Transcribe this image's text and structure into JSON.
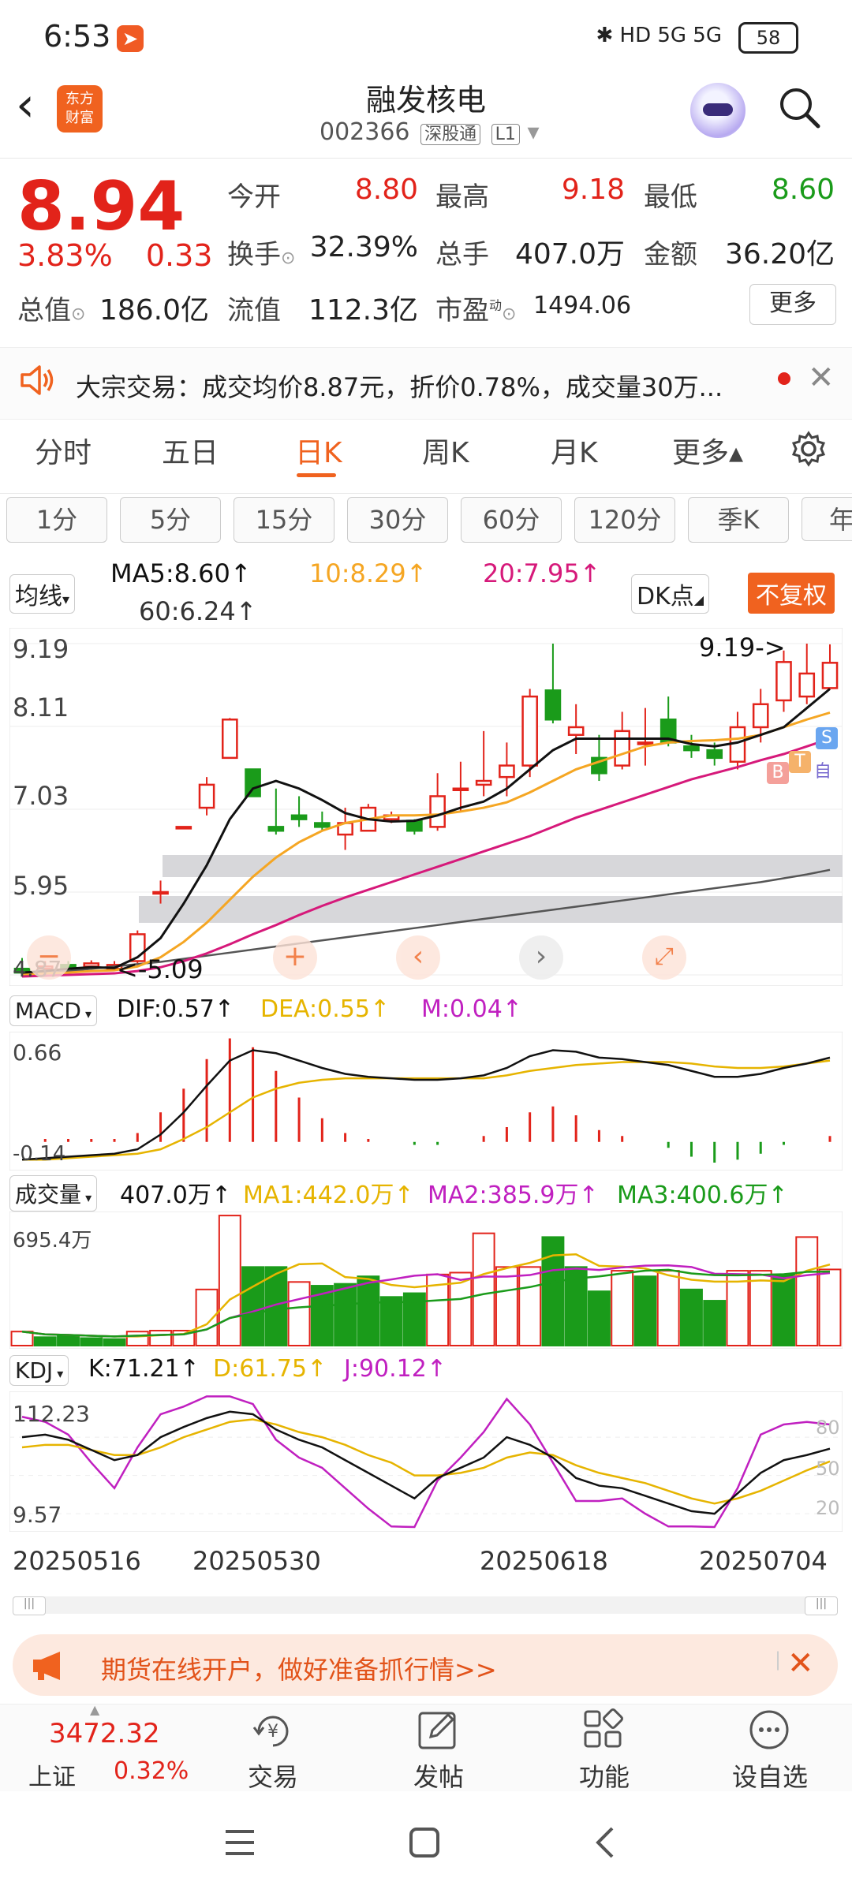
{
  "status_bar": {
    "time": "6:53",
    "icons": "✱ HD 5G 5G",
    "battery": "58"
  },
  "header": {
    "logo_line1": "东方",
    "logo_line2": "财富",
    "title": "融发核电",
    "code": "002366",
    "tag1": "深股通",
    "tag2": "L1"
  },
  "quote": {
    "price": "8.94",
    "change_pct": "3.83%",
    "change": "0.33",
    "open_label": "今开",
    "open": "8.80",
    "high_label": "最高",
    "high": "9.18",
    "low_label": "最低",
    "low": "8.60",
    "turnover_label": "换手",
    "turnover": "32.39%",
    "volume_label": "总手",
    "volume": "407.0万",
    "amount_label": "金额",
    "amount": "36.20亿",
    "mktcap_label": "总值",
    "mktcap": "186.0亿",
    "float_label": "流值",
    "float": "112.3亿",
    "pe_label": "市盈",
    "pe_sup": "动",
    "pe": "1494.06",
    "more": "更多"
  },
  "notice": {
    "text": "大宗交易：成交均价8.87元，折价0.78%，成交量30万..."
  },
  "tabs": [
    "分时",
    "五日",
    "日K",
    "周K",
    "月K",
    "更多▴"
  ],
  "periods": [
    "1分",
    "5分",
    "15分",
    "30分",
    "60分",
    "120分",
    "季K",
    "年"
  ],
  "indicators": {
    "ma_btn": "均线",
    "ma5": "MA5:8.60↑",
    "ma10": "10:8.29↑",
    "ma20": "20:7.95↑",
    "ma60": "60:6.24↑",
    "dk_btn": "DK点",
    "fuquan_btn": "不复权",
    "price_high_note": "9.19->",
    "price_low_note": "<-5.09",
    "ticks": [
      "9.19",
      "8.11",
      "7.03",
      "5.95",
      "4.87"
    ],
    "signal_b": "B",
    "signal_t": "T",
    "signal_s": "S",
    "signal_zi": "自"
  },
  "macd": {
    "btn": "MACD",
    "dif": "DIF:0.57↑",
    "dea": "DEA:0.55↑",
    "m": "M:0.04↑",
    "top": "0.66",
    "bottom": "-0.14"
  },
  "volume": {
    "btn": "成交量",
    "total": "407.0万↑",
    "ma1": "MA1:442.0万↑",
    "ma2": "MA2:385.9万↑",
    "ma3": "MA3:400.6万↑",
    "top": "695.4万"
  },
  "kdj": {
    "btn": "KDJ",
    "k": "K:71.21↑",
    "d": "D:61.75↑",
    "j": "J:90.12↑",
    "top": "112.23",
    "bottom": "9.57",
    "r80": "80",
    "r50": "50",
    "r20": "20"
  },
  "dates": [
    "20250516",
    "20250530",
    "20250618",
    "20250704"
  ],
  "ad": {
    "text": "期货在线开户，做好准备抓行情>>"
  },
  "bottom_nav": {
    "index_value": "3472.32",
    "index_name": "上证",
    "index_pct": "0.32%",
    "trade": "交易",
    "post": "发帖",
    "func": "功能",
    "watch": "设自选"
  },
  "colors": {
    "up": "#e2231a",
    "down": "#1a9b1a",
    "accent": "#f0621f",
    "ma5": "#111111",
    "ma10": "#f5a623",
    "ma20": "#d6197a",
    "ma60": "#555555"
  },
  "chart_data": {
    "type": "candlestick",
    "price_ticks": [
      9.19,
      8.11,
      7.03,
      5.95,
      4.87
    ],
    "ylim": [
      4.87,
      9.19
    ],
    "candles": [
      {
        "o": 4.95,
        "c": 4.9,
        "h": 5.09,
        "l": 4.88
      },
      {
        "o": 4.95,
        "c": 4.98,
        "h": 5.05,
        "l": 4.9
      },
      {
        "o": 5.0,
        "c": 4.95,
        "h": 5.05,
        "l": 4.92
      },
      {
        "o": 4.98,
        "c": 5.02,
        "h": 5.06,
        "l": 4.95
      },
      {
        "o": 4.95,
        "c": 5.0,
        "h": 5.05,
        "l": 4.92
      },
      {
        "o": 5.05,
        "c": 5.4,
        "h": 5.45,
        "l": 5.0
      },
      {
        "o": 5.95,
        "c": 5.95,
        "h": 6.1,
        "l": 5.8
      },
      {
        "o": 6.8,
        "c": 6.8,
        "h": 6.8,
        "l": 6.8
      },
      {
        "o": 7.05,
        "c": 7.35,
        "h": 7.45,
        "l": 6.95
      },
      {
        "o": 7.7,
        "c": 8.2,
        "h": 8.22,
        "l": 7.7
      },
      {
        "o": 7.55,
        "c": 7.2,
        "h": 7.55,
        "l": 7.2
      },
      {
        "o": 6.8,
        "c": 6.75,
        "h": 7.3,
        "l": 6.7
      },
      {
        "o": 6.95,
        "c": 6.9,
        "h": 7.2,
        "l": 6.8
      },
      {
        "o": 6.85,
        "c": 6.8,
        "h": 7.0,
        "l": 6.75
      },
      {
        "o": 6.7,
        "c": 6.85,
        "h": 7.05,
        "l": 6.5
      },
      {
        "o": 6.75,
        "c": 7.05,
        "h": 7.1,
        "l": 6.75
      },
      {
        "o": 6.9,
        "c": 6.95,
        "h": 7.0,
        "l": 6.85
      },
      {
        "o": 6.88,
        "c": 6.75,
        "h": 6.9,
        "l": 6.7
      },
      {
        "o": 6.8,
        "c": 7.2,
        "h": 7.5,
        "l": 6.75
      },
      {
        "o": 7.3,
        "c": 7.3,
        "h": 7.65,
        "l": 7.0
      },
      {
        "o": 7.35,
        "c": 7.4,
        "h": 8.05,
        "l": 7.2
      },
      {
        "o": 7.45,
        "c": 7.6,
        "h": 7.9,
        "l": 7.2
      },
      {
        "o": 7.6,
        "c": 8.5,
        "h": 8.6,
        "l": 7.45
      },
      {
        "o": 8.58,
        "c": 8.2,
        "h": 9.19,
        "l": 8.15
      },
      {
        "o": 8.0,
        "c": 8.1,
        "h": 8.4,
        "l": 7.75
      },
      {
        "o": 7.7,
        "c": 7.5,
        "h": 8.0,
        "l": 7.4
      },
      {
        "o": 7.6,
        "c": 8.05,
        "h": 8.3,
        "l": 7.55
      },
      {
        "o": 7.9,
        "c": 7.9,
        "h": 8.35,
        "l": 7.6
      },
      {
        "o": 8.2,
        "c": 7.9,
        "h": 8.5,
        "l": 7.85
      },
      {
        "o": 7.85,
        "c": 7.8,
        "h": 8.0,
        "l": 7.7
      },
      {
        "o": 7.8,
        "c": 7.7,
        "h": 7.9,
        "l": 7.6
      },
      {
        "o": 7.65,
        "c": 8.1,
        "h": 8.3,
        "l": 7.55
      },
      {
        "o": 8.1,
        "c": 8.4,
        "h": 8.6,
        "l": 7.9
      },
      {
        "o": 8.45,
        "c": 8.95,
        "h": 9.1,
        "l": 8.3
      },
      {
        "o": 8.5,
        "c": 8.8,
        "h": 9.19,
        "l": 8.4
      },
      {
        "o": 8.61,
        "c": 8.94,
        "h": 9.18,
        "l": 8.6
      }
    ],
    "ma5": [
      4.9,
      4.92,
      4.95,
      4.97,
      4.96,
      5.1,
      5.35,
      5.8,
      6.3,
      6.9,
      7.3,
      7.4,
      7.3,
      7.15,
      6.98,
      6.9,
      6.87,
      6.88,
      6.95,
      7.05,
      7.13,
      7.3,
      7.55,
      7.8,
      7.95,
      7.95,
      7.95,
      7.95,
      7.95,
      7.88,
      7.85,
      7.9,
      8.0,
      8.1,
      8.35,
      8.6
    ],
    "ma10": [
      4.88,
      4.89,
      4.9,
      4.92,
      4.93,
      4.98,
      5.1,
      5.3,
      5.55,
      5.85,
      6.15,
      6.4,
      6.6,
      6.75,
      6.85,
      6.9,
      6.95,
      6.95,
      6.96,
      7.0,
      7.05,
      7.12,
      7.25,
      7.4,
      7.55,
      7.65,
      7.75,
      7.85,
      7.9,
      7.92,
      7.93,
      7.95,
      8.0,
      8.1,
      8.2,
      8.29
    ],
    "ma20": [
      4.85,
      4.86,
      4.87,
      4.88,
      4.89,
      4.92,
      4.97,
      5.05,
      5.15,
      5.27,
      5.4,
      5.52,
      5.65,
      5.77,
      5.88,
      5.98,
      6.08,
      6.18,
      6.28,
      6.38,
      6.48,
      6.58,
      6.68,
      6.8,
      6.92,
      7.02,
      7.12,
      7.22,
      7.32,
      7.42,
      7.5,
      7.58,
      7.67,
      7.75,
      7.85,
      7.95
    ],
    "ma60": [
      4.87,
      4.89,
      4.92,
      4.95,
      4.98,
      5.01,
      5.04,
      5.08,
      5.12,
      5.16,
      5.2,
      5.24,
      5.28,
      5.32,
      5.36,
      5.4,
      5.44,
      5.48,
      5.52,
      5.56,
      5.6,
      5.64,
      5.68,
      5.72,
      5.76,
      5.8,
      5.84,
      5.88,
      5.92,
      5.96,
      6.0,
      6.04,
      6.08,
      6.13,
      6.18,
      6.24
    ],
    "macd_ylim": [
      -0.14,
      0.66
    ],
    "dif": [
      -0.12,
      -0.11,
      -0.1,
      -0.09,
      -0.08,
      -0.05,
      0.05,
      0.2,
      0.38,
      0.55,
      0.62,
      0.6,
      0.55,
      0.5,
      0.46,
      0.44,
      0.43,
      0.42,
      0.42,
      0.43,
      0.45,
      0.5,
      0.58,
      0.62,
      0.61,
      0.57,
      0.56,
      0.54,
      0.52,
      0.48,
      0.44,
      0.44,
      0.46,
      0.5,
      0.53,
      0.57
    ],
    "dea": [
      -0.12,
      -0.12,
      -0.11,
      -0.1,
      -0.09,
      -0.08,
      -0.05,
      0.02,
      0.1,
      0.2,
      0.3,
      0.36,
      0.4,
      0.42,
      0.43,
      0.43,
      0.43,
      0.43,
      0.43,
      0.43,
      0.43,
      0.45,
      0.48,
      0.5,
      0.52,
      0.53,
      0.54,
      0.54,
      0.54,
      0.53,
      0.51,
      0.5,
      0.5,
      0.51,
      0.53,
      0.55
    ],
    "vol_ylim": [
      0,
      695.4
    ],
    "volumes": [
      75,
      45,
      50,
      40,
      35,
      75,
      80,
      80,
      300,
      695,
      420,
      420,
      340,
      320,
      330,
      370,
      260,
      280,
      380,
      390,
      600,
      420,
      420,
      580,
      420,
      290,
      400,
      370,
      400,
      300,
      240,
      400,
      400,
      380,
      580,
      407
    ],
    "vol_up": [
      true,
      false,
      false,
      false,
      false,
      true,
      true,
      true,
      true,
      true,
      false,
      false,
      true,
      false,
      false,
      false,
      false,
      false,
      true,
      true,
      true,
      true,
      true,
      false,
      false,
      false,
      true,
      false,
      true,
      false,
      false,
      true,
      true,
      false,
      true,
      true
    ],
    "kdj_ylim": [
      9.57,
      112.23
    ],
    "k": [
      80,
      82,
      78,
      70,
      62,
      66,
      80,
      88,
      95,
      100,
      98,
      86,
      78,
      72,
      62,
      52,
      42,
      32,
      48,
      56,
      64,
      80,
      74,
      64,
      48,
      42,
      40,
      34,
      28,
      22,
      20,
      36,
      52,
      62,
      66,
      71
    ],
    "d": [
      72,
      74,
      74,
      70,
      66,
      66,
      72,
      80,
      86,
      92,
      94,
      90,
      84,
      80,
      74,
      66,
      60,
      50,
      50,
      52,
      56,
      64,
      68,
      66,
      58,
      52,
      48,
      44,
      38,
      32,
      28,
      32,
      38,
      46,
      54,
      61
    ],
    "j": [
      96,
      92,
      82,
      60,
      40,
      72,
      98,
      104,
      112,
      112,
      106,
      78,
      64,
      56,
      40,
      24,
      10,
      8,
      46,
      64,
      84,
      110,
      90,
      60,
      30,
      30,
      32,
      20,
      10,
      10,
      4,
      40,
      82,
      90,
      92,
      90
    ]
  }
}
